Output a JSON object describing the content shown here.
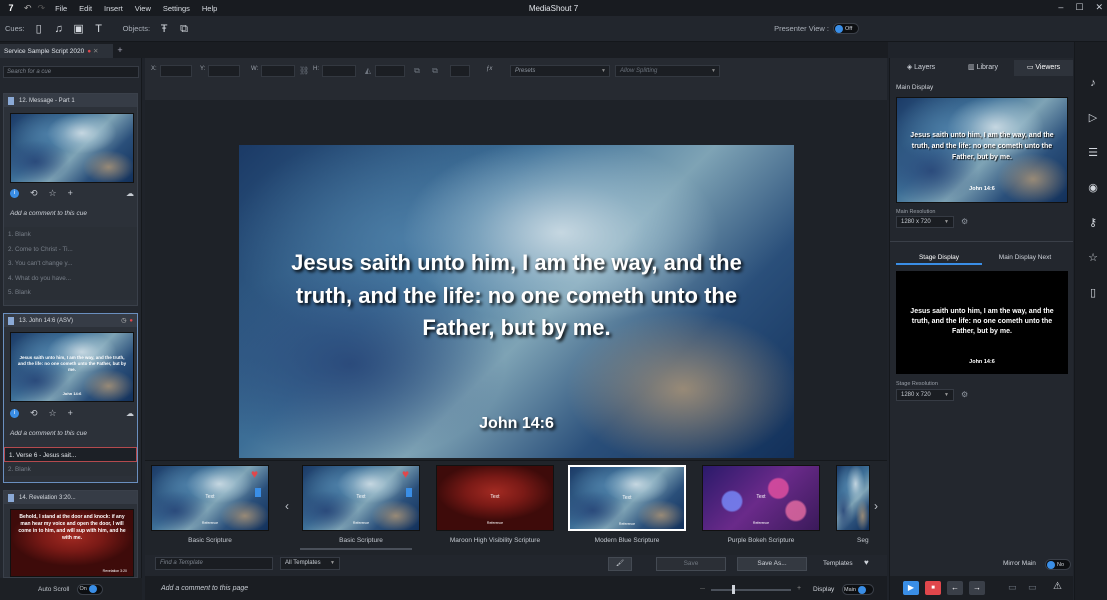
{
  "app": {
    "logo": "7",
    "title": "MediaShout 7",
    "menu": [
      "File",
      "Edit",
      "Insert",
      "View",
      "Settings",
      "Help"
    ]
  },
  "toolbar": {
    "cues_label": "Cues:",
    "objects_label": "Objects:",
    "presenter_view_label": "Presenter View :",
    "presenter_view_state": "Off"
  },
  "tabs": {
    "doc": "Service Sample Script 2020",
    "add": "+"
  },
  "left": {
    "search_placeholder": "Search for a cue",
    "cues": [
      {
        "title": "12.  Message - Part 1",
        "comment": "Add a comment to this cue",
        "slides": [
          "1. Blank",
          "2. Come to Christ - Ti...",
          "3. You can't change y...",
          "4. What do you have...",
          "5. Blank"
        ]
      },
      {
        "title": "13.  John 14:6 (ASV)",
        "thumb_text": "Jesus saith unto him, I am the way, and the truth, and the life: no one cometh unto the Father, but by me.",
        "thumb_ref": "John 14:6",
        "comment": "Add a comment to this cue",
        "slides": [
          "1. Verse 6 - Jesus sait...",
          "2. Blank"
        ]
      },
      {
        "title": "14.  Revelation 3:20...",
        "thumb_text": "Behold, I stand at the door and knock: if any man hear my voice and open the door, I will come in to him, and will sup with him, and he with me.",
        "thumb_ref": "Revelation 3:20"
      }
    ],
    "auto_scroll_label": "Auto Scroll",
    "auto_scroll_state": "On"
  },
  "editor": {
    "x_label": "X:",
    "y_label": "Y:",
    "w_label": "W:",
    "h_label": "H:",
    "fx_label": "ƒx",
    "presets_label": "Presets",
    "splitting_label": "Allow Splitting"
  },
  "slide": {
    "verse": "Jesus saith unto him, I am the way, and the truth, and the life: no one cometh unto the Father, but by me.",
    "reference": "John 14:6"
  },
  "templates": {
    "items": [
      {
        "name": "Basic Scripture",
        "text": "Text",
        "ref": "Reference"
      },
      {
        "name": "Basic Scripture",
        "text": "Text",
        "ref": "Reference"
      },
      {
        "name": "Maroon High Visibility Scripture",
        "text": "Text",
        "ref": "Reference"
      },
      {
        "name": "Modern Blue Scripture",
        "text": "Text",
        "ref": "Reference"
      },
      {
        "name": "Purple Bokeh Scripture",
        "text": "Text",
        "ref": "Reference"
      },
      {
        "name": "Seg"
      }
    ],
    "find_placeholder": "Find a Template",
    "filter_value": "All Templates",
    "save_label": "Save",
    "save_as_label": "Save As...",
    "templates_label": "Templates",
    "page_comment": "Add a comment to this page",
    "display_label": "Display",
    "display_value": "Main"
  },
  "right": {
    "tabs": [
      "Layers",
      "Library",
      "Viewers"
    ],
    "main_display_label": "Main Display",
    "main_resolution_label": "Main Resolution",
    "main_resolution_value": "1280 x 720",
    "stage_tabs": [
      "Stage Display",
      "Main Display Next"
    ],
    "stage_resolution_label": "Stage Resolution",
    "stage_resolution_value": "1280 x 720",
    "preview_text": "Jesus saith unto him, I am the way, and the truth, and the life: no one cometh unto the Father, but by me.",
    "preview_ref": "John 14:6",
    "mirror_label": "Mirror Main",
    "mirror_state": "No"
  },
  "colors": {
    "accent": "#3a8ee6",
    "danger": "#e0474c",
    "panel": "#23272e"
  }
}
